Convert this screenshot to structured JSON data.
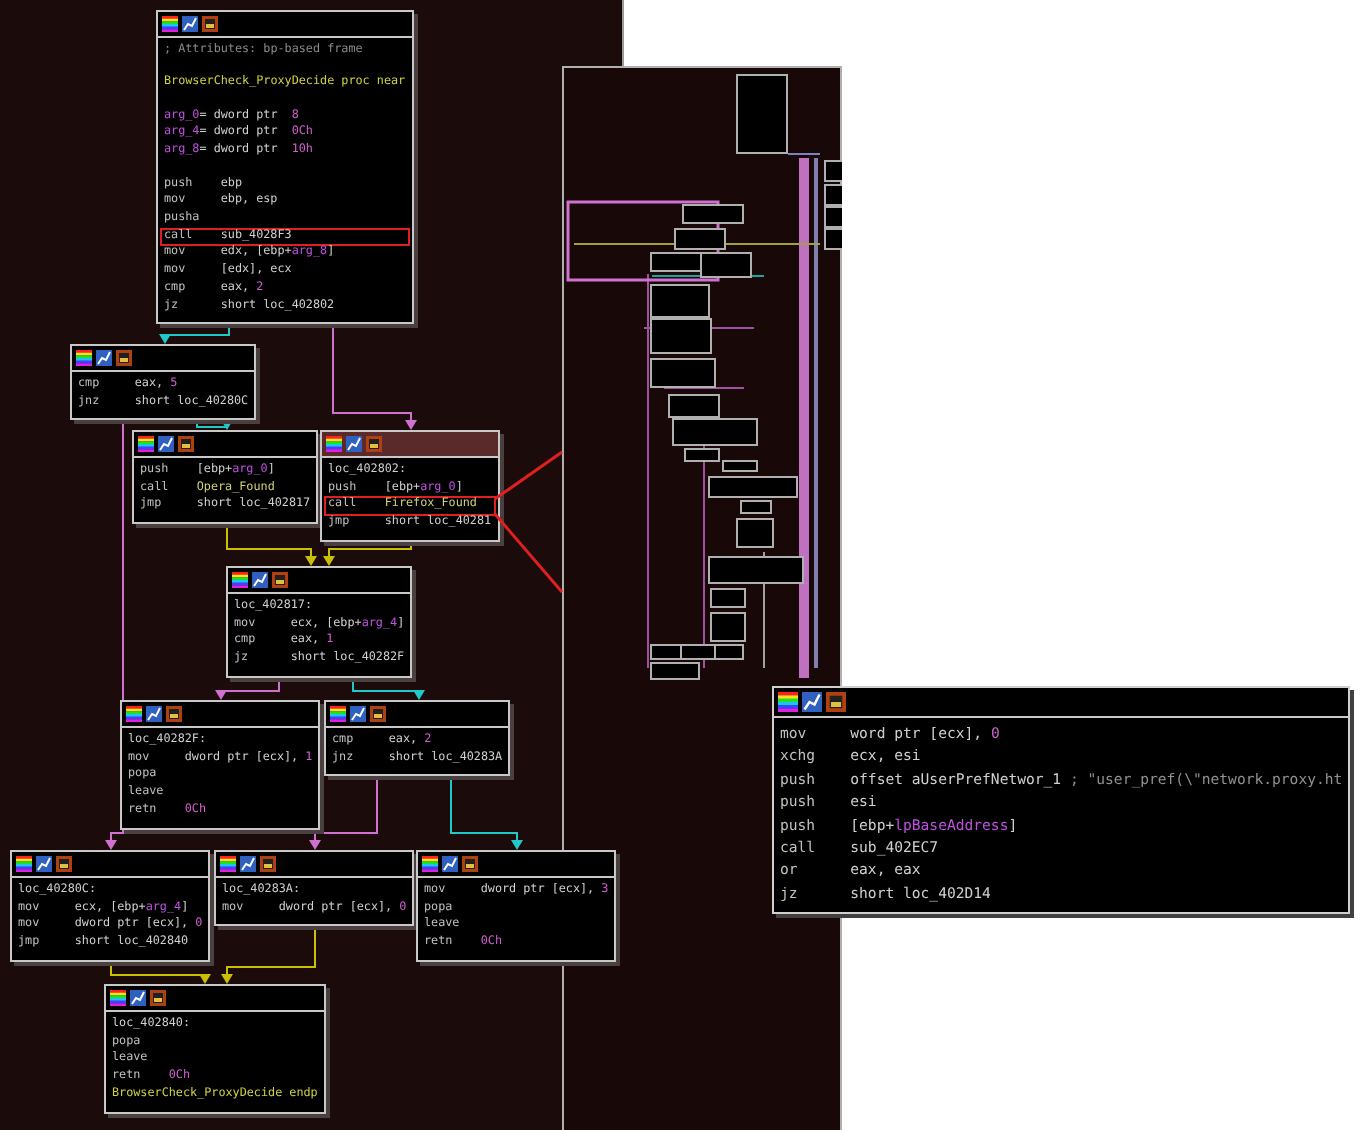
{
  "nodes": [
    {
      "selected": false,
      "exits": [
        {
          "kind": "fallthrough"
        },
        {
          "kind": "taken"
        }
      ],
      "sections": [
        [
          {
            "kind": "comment",
            "text": "; Attributes: bp-based frame",
            "boxed": false
          }
        ],
        [
          {
            "kind": "proc",
            "text": "BrowserCheck_ProxyDecide proc near",
            "boxed": false
          }
        ],
        [
          {
            "kind": "decl",
            "parts": [
              {
                "text": "arg_0",
                "kind": "var"
              },
              {
                "text": "= dword ptr  ",
                "kind": "text"
              },
              {
                "text": "8",
                "kind": "num"
              }
            ],
            "boxed": false
          },
          {
            "kind": "decl",
            "parts": [
              {
                "text": "arg_4",
                "kind": "var"
              },
              {
                "text": "= dword ptr  ",
                "kind": "text"
              },
              {
                "text": "0Ch",
                "kind": "num"
              }
            ],
            "boxed": false
          },
          {
            "kind": "decl",
            "parts": [
              {
                "text": "arg_8",
                "kind": "var"
              },
              {
                "text": "= dword ptr  ",
                "kind": "text"
              },
              {
                "text": "10h",
                "kind": "num"
              }
            ],
            "boxed": false
          }
        ],
        [
          {
            "kind": "instr",
            "op": "push",
            "parts": [
              {
                "text": "ebp",
                "kind": "text"
              }
            ],
            "boxed": false
          },
          {
            "kind": "instr",
            "op": "mov",
            "parts": [
              {
                "text": "ebp, esp",
                "kind": "text"
              }
            ],
            "boxed": false
          },
          {
            "kind": "instr",
            "op": "pusha",
            "boxed": false
          },
          {
            "kind": "instr",
            "op": "call",
            "parts": [
              {
                "text": "sub_4028F3",
                "kind": "text"
              }
            ],
            "boxed": true
          },
          {
            "kind": "instr",
            "op": "mov",
            "parts": [
              {
                "text": "edx, [ebp+",
                "kind": "text"
              },
              {
                "text": "arg_8",
                "kind": "var"
              },
              {
                "text": "]",
                "kind": "text"
              }
            ],
            "boxed": false
          },
          {
            "kind": "instr",
            "op": "mov",
            "parts": [
              {
                "text": "[edx], ecx",
                "kind": "text"
              }
            ],
            "boxed": false
          },
          {
            "kind": "instr",
            "op": "cmp",
            "parts": [
              {
                "text": "eax, ",
                "kind": "text"
              },
              {
                "text": "2",
                "kind": "num"
              }
            ],
            "boxed": false
          },
          {
            "kind": "instr",
            "op": "jz",
            "parts": [
              {
                "text": "short loc_402802",
                "kind": "text"
              }
            ],
            "boxed": false
          }
        ]
      ]
    },
    {
      "selected": false,
      "exits": [
        {
          "kind": "taken"
        },
        {
          "kind": "fallthrough"
        }
      ],
      "sections": [
        [
          {
            "kind": "instr",
            "op": "cmp",
            "parts": [
              {
                "text": "eax, ",
                "kind": "text"
              },
              {
                "text": "5",
                "kind": "num"
              }
            ],
            "boxed": false
          },
          {
            "kind": "instr",
            "op": "jnz",
            "parts": [
              {
                "text": "short loc_40280C",
                "kind": "text"
              }
            ],
            "boxed": false
          }
        ]
      ]
    },
    {
      "selected": false,
      "exits": [
        {
          "kind": "jump"
        }
      ],
      "sections": [
        [
          {
            "kind": "instr",
            "op": "push",
            "parts": [
              {
                "text": "[ebp+",
                "kind": "text"
              },
              {
                "text": "arg_0",
                "kind": "var"
              },
              {
                "text": "]",
                "kind": "text"
              }
            ],
            "boxed": false
          },
          {
            "kind": "instr",
            "op": "call",
            "parts": [
              {
                "text": "Opera_Found",
                "kind": "func"
              }
            ],
            "boxed": false
          },
          {
            "kind": "instr",
            "op": "jmp",
            "parts": [
              {
                "text": "short loc_402817",
                "kind": "text"
              }
            ],
            "boxed": false
          }
        ]
      ]
    },
    {
      "selected": true,
      "exits": [
        {
          "kind": "jump"
        }
      ],
      "sections": [
        [
          {
            "kind": "label",
            "text": "loc_402802:",
            "boxed": false
          },
          {
            "kind": "instr",
            "op": "push",
            "parts": [
              {
                "text": "[ebp+",
                "kind": "text"
              },
              {
                "text": "arg_0",
                "kind": "var"
              },
              {
                "text": "]",
                "kind": "text"
              }
            ],
            "boxed": false
          },
          {
            "kind": "instr",
            "op": "call",
            "parts": [
              {
                "text": "Firefox_Found",
                "kind": "func"
              }
            ],
            "boxed": true
          },
          {
            "kind": "instr",
            "op": "jmp",
            "parts": [
              {
                "text": "short loc_40281",
                "kind": "text"
              }
            ],
            "boxed": false
          }
        ]
      ]
    },
    {
      "selected": false,
      "exits": [
        {
          "kind": "taken"
        },
        {
          "kind": "fallthrough"
        }
      ],
      "sections": [
        [
          {
            "kind": "label",
            "text": "loc_402817:",
            "boxed": false
          },
          {
            "kind": "instr",
            "op": "mov",
            "parts": [
              {
                "text": "ecx, [ebp+",
                "kind": "text"
              },
              {
                "text": "arg_4",
                "kind": "var"
              },
              {
                "text": "]",
                "kind": "text"
              }
            ],
            "boxed": false
          },
          {
            "kind": "instr",
            "op": "cmp",
            "parts": [
              {
                "text": "eax, ",
                "kind": "text"
              },
              {
                "text": "1",
                "kind": "num"
              }
            ],
            "boxed": false
          },
          {
            "kind": "instr",
            "op": "jz",
            "parts": [
              {
                "text": "short loc_40282F",
                "kind": "text"
              }
            ],
            "boxed": false
          }
        ]
      ]
    },
    {
      "selected": false,
      "sections": [
        [
          {
            "kind": "label",
            "text": "loc_40282F:",
            "boxed": false
          },
          {
            "kind": "instr",
            "op": "mov",
            "parts": [
              {
                "text": "dword ptr [ecx], ",
                "kind": "text"
              },
              {
                "text": "1",
                "kind": "num"
              }
            ],
            "boxed": false
          },
          {
            "kind": "instr",
            "op": "popa",
            "boxed": false
          },
          {
            "kind": "instr",
            "op": "leave",
            "boxed": false
          },
          {
            "kind": "instr",
            "op": "retn",
            "parts": [
              {
                "text": "0Ch",
                "kind": "num"
              }
            ],
            "boxed": false
          }
        ]
      ]
    },
    {
      "selected": false,
      "exits": [
        {
          "kind": "taken"
        },
        {
          "kind": "fallthrough"
        }
      ],
      "sections": [
        [
          {
            "kind": "instr",
            "op": "cmp",
            "parts": [
              {
                "text": "eax, ",
                "kind": "text"
              },
              {
                "text": "2",
                "kind": "num"
              }
            ],
            "boxed": false
          },
          {
            "kind": "instr",
            "op": "jnz",
            "parts": [
              {
                "text": "short loc_40283A",
                "kind": "text"
              }
            ],
            "boxed": false
          }
        ]
      ]
    },
    {
      "selected": false,
      "exits": [
        {
          "kind": "jump"
        }
      ],
      "sections": [
        [
          {
            "kind": "label",
            "text": "loc_40280C:",
            "boxed": false
          },
          {
            "kind": "instr",
            "op": "mov",
            "parts": [
              {
                "text": "ecx, [ebp+",
                "kind": "text"
              },
              {
                "text": "arg_4",
                "kind": "var"
              },
              {
                "text": "]",
                "kind": "text"
              }
            ],
            "boxed": false
          },
          {
            "kind": "instr",
            "op": "mov",
            "parts": [
              {
                "text": "dword ptr [ecx], ",
                "kind": "text"
              },
              {
                "text": "0",
                "kind": "num"
              }
            ],
            "boxed": false
          },
          {
            "kind": "instr",
            "op": "jmp",
            "parts": [
              {
                "text": "short loc_402840",
                "kind": "text"
              }
            ],
            "boxed": false
          }
        ]
      ]
    },
    {
      "selected": false,
      "exits": [
        {
          "kind": "jump"
        }
      ],
      "sections": [
        [
          {
            "kind": "label",
            "text": "loc_40283A:",
            "boxed": false
          },
          {
            "kind": "instr",
            "op": "mov",
            "parts": [
              {
                "text": "dword ptr [ecx], ",
                "kind": "text"
              },
              {
                "text": "0",
                "kind": "num"
              }
            ],
            "boxed": false
          }
        ]
      ]
    },
    {
      "selected": false,
      "sections": [
        [
          {
            "kind": "instr",
            "op": "mov",
            "parts": [
              {
                "text": "dword ptr [ecx], ",
                "kind": "text"
              },
              {
                "text": "3",
                "kind": "num"
              }
            ],
            "boxed": false
          },
          {
            "kind": "instr",
            "op": "popa",
            "boxed": false
          },
          {
            "kind": "instr",
            "op": "leave",
            "boxed": false
          },
          {
            "kind": "instr",
            "op": "retn",
            "parts": [
              {
                "text": "0Ch",
                "kind": "num"
              }
            ],
            "boxed": false
          }
        ]
      ]
    },
    {
      "selected": false,
      "sections": [
        [
          {
            "kind": "label",
            "text": "loc_402840:",
            "boxed": false
          },
          {
            "kind": "instr",
            "op": "popa",
            "boxed": false
          },
          {
            "kind": "instr",
            "op": "leave",
            "boxed": false
          },
          {
            "kind": "instr",
            "op": "retn",
            "parts": [
              {
                "text": "0Ch",
                "kind": "num"
              }
            ],
            "boxed": false
          },
          {
            "kind": "proc",
            "text": "BrowserCheck_ProxyDecide endp",
            "boxed": false
          }
        ]
      ]
    }
  ],
  "detail_node": {
    "selected": false,
    "sections": [
      [
        {
          "kind": "instr",
          "op": "mov",
          "parts": [
            {
              "text": "word ptr [ecx], ",
              "kind": "text"
            },
            {
              "text": "0",
              "kind": "num"
            }
          ],
          "boxed": false
        },
        {
          "kind": "instr",
          "op": "xchg",
          "parts": [
            {
              "text": "ecx, esi",
              "kind": "text"
            }
          ],
          "boxed": false
        },
        {
          "kind": "instr",
          "op": "push",
          "parts": [
            {
              "text": "offset aUserPrefNetwor_1 ",
              "kind": "text"
            },
            {
              "text": "; \"user_pref(\\\"network.proxy.ht",
              "kind": "cmt"
            }
          ],
          "boxed": false
        },
        {
          "kind": "instr",
          "op": "push",
          "parts": [
            {
              "text": "esi",
              "kind": "text"
            }
          ],
          "boxed": false
        },
        {
          "kind": "instr",
          "op": "push",
          "parts": [
            {
              "text": "[ebp+",
              "kind": "text"
            },
            {
              "text": "lpBaseAddress",
              "kind": "var"
            },
            {
              "text": "]",
              "kind": "text"
            }
          ],
          "boxed": false
        },
        {
          "kind": "instr",
          "op": "call",
          "parts": [
            {
              "text": "sub_402EC7",
              "kind": "text"
            }
          ],
          "boxed": false
        },
        {
          "kind": "instr",
          "op": "or",
          "parts": [
            {
              "text": "eax, eax",
              "kind": "text"
            }
          ],
          "boxed": false
        },
        {
          "kind": "instr",
          "op": "jz",
          "parts": [
            {
              "text": "short loc_402D14",
              "kind": "text"
            }
          ],
          "boxed": false
        }
      ]
    ]
  }
}
